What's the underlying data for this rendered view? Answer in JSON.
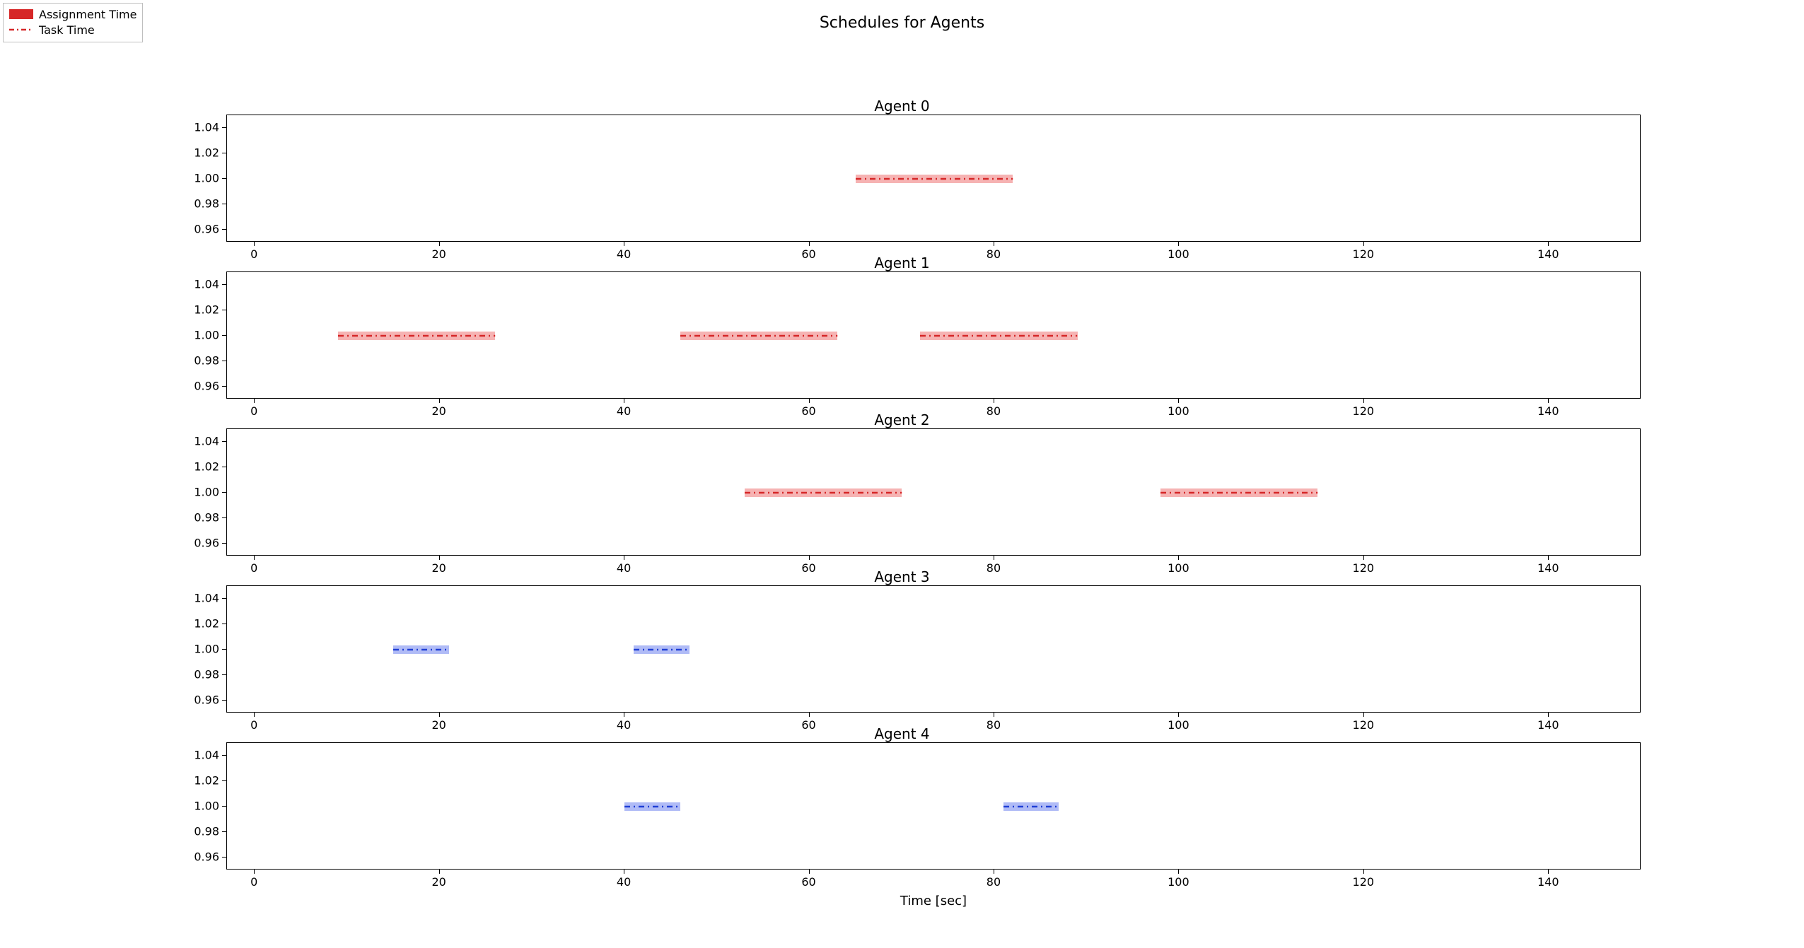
{
  "chart_data": {
    "type": "bar",
    "title": "Schedules for Agents",
    "xlabel": "Time [sec]",
    "xlim": [
      -3,
      150
    ],
    "ylim": [
      0.95,
      1.05
    ],
    "xticks": [
      0,
      20,
      40,
      60,
      80,
      100,
      120,
      140
    ],
    "yticks": [
      0.96,
      0.98,
      1.0,
      1.02,
      1.04
    ],
    "legend": [
      {
        "label": "Assignment Time",
        "kind": "patch",
        "color": "#d62728"
      },
      {
        "label": "Task Time",
        "kind": "dash-line",
        "color": "#d62728"
      }
    ],
    "series": [
      {
        "name": "Agent 0",
        "color": "#f08080",
        "line_color": "#d62728",
        "bars": [
          {
            "start": 65,
            "width": 17
          }
        ]
      },
      {
        "name": "Agent 1",
        "color": "#f08080",
        "line_color": "#d62728",
        "bars": [
          {
            "start": 9,
            "width": 17
          },
          {
            "start": 46,
            "width": 17
          },
          {
            "start": 72,
            "width": 17
          }
        ]
      },
      {
        "name": "Agent 2",
        "color": "#f08080",
        "line_color": "#d62728",
        "bars": [
          {
            "start": 53,
            "width": 17
          },
          {
            "start": 98,
            "width": 17
          }
        ]
      },
      {
        "name": "Agent 3",
        "color": "#7b8ef0",
        "line_color": "#1f3fd6",
        "bars": [
          {
            "start": 15,
            "width": 6
          },
          {
            "start": 41,
            "width": 6
          }
        ]
      },
      {
        "name": "Agent 4",
        "color": "#7b8ef0",
        "line_color": "#1f3fd6",
        "bars": [
          {
            "start": 40,
            "width": 6
          },
          {
            "start": 81,
            "width": 6
          }
        ]
      }
    ]
  },
  "legend_labels": {
    "assignment": "Assignment Time",
    "task": "Task Time"
  },
  "suptitle": "Schedules for Agents",
  "xaxis_label": "Time [sec]",
  "ytick_labels": [
    "0.96",
    "0.98",
    "1.00",
    "1.02",
    "1.04"
  ],
  "xtick_labels": [
    "0",
    "20",
    "40",
    "60",
    "80",
    "100",
    "120",
    "140"
  ]
}
